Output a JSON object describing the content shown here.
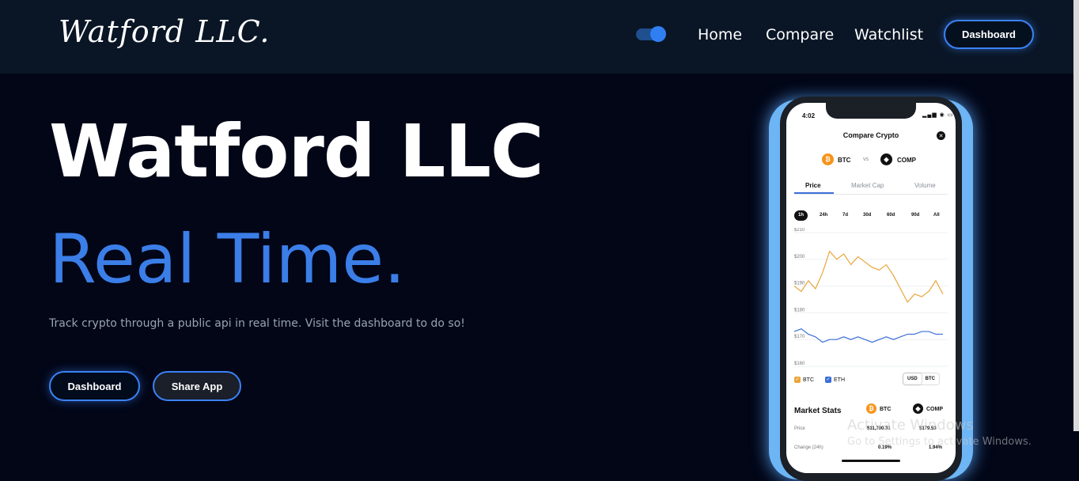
{
  "nav": {
    "logo": "Watford LLC.",
    "links": [
      "Home",
      "Compare",
      "Watchlist"
    ],
    "dashboard_label": "Dashboard"
  },
  "hero": {
    "title": "Watford LLC",
    "subtitle": "Real Time.",
    "description": "Track crypto through a public api in real time. Visit the dashboard to do so!",
    "dashboard_button": "Dashboard",
    "share_button": "Share App"
  },
  "phone": {
    "time": "4:02",
    "title": "Compare Crypto",
    "coin_a": "BTC",
    "vs": "vs",
    "coin_b": "COMP",
    "tabs": [
      "Price",
      "Market Cap",
      "Volume"
    ],
    "ranges": [
      "1h",
      "24h",
      "7d",
      "30d",
      "60d",
      "90d",
      "All"
    ],
    "legend": [
      "BTC",
      "ETH"
    ],
    "currency": [
      "USD",
      "BTC"
    ],
    "stats_title": "Market Stats",
    "stats": [
      {
        "label": "Price",
        "a": "$11,700.31",
        "b": "$179.53"
      },
      {
        "label": "Change (24h)",
        "a": "0.19%",
        "b": "1.94%"
      }
    ]
  },
  "chart_data": {
    "type": "line",
    "yticks": [
      "$210",
      "$200",
      "$190",
      "$180",
      "$170",
      "$160"
    ],
    "ylim": [
      160,
      210
    ],
    "series": [
      {
        "name": "BTC",
        "color": "#e9a53a",
        "values": [
          190,
          188,
          192,
          189,
          195,
          203,
          200,
          202,
          198,
          201,
          199,
          197,
          196,
          198,
          194,
          189,
          184,
          187,
          186,
          188,
          192,
          187
        ]
      },
      {
        "name": "ETH",
        "color": "#3b6fd8",
        "values": [
          173,
          174,
          172,
          171,
          169,
          170,
          170,
          171,
          170,
          171,
          170,
          169,
          170,
          171,
          170,
          171,
          172,
          172,
          173,
          173,
          172,
          172
        ]
      }
    ]
  },
  "colors": {
    "accent": "#3b82f6",
    "background": "#020617",
    "nav": "#0a1626"
  },
  "watermark": {
    "line1": "Activate Windows",
    "line2": "Go to Settings to activate Windows."
  }
}
